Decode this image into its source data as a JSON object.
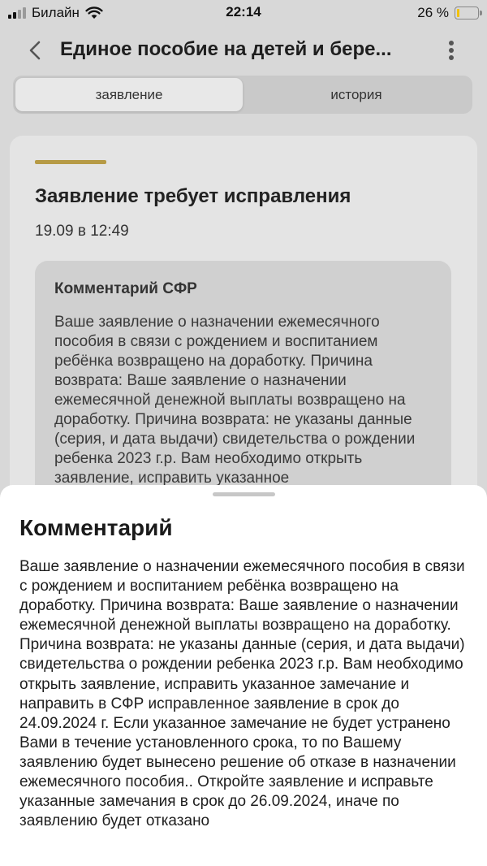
{
  "status_bar": {
    "carrier": "Билайн",
    "time": "22:14",
    "battery_percent": "26 %",
    "battery_level": 0.26,
    "battery_color": "#f3c100"
  },
  "nav": {
    "back_icon": "chevron-left-icon",
    "title": "Единое пособие на детей и бере...",
    "more_icon": "more-vertical-icon"
  },
  "tabs": [
    {
      "label": "заявление",
      "active": true
    },
    {
      "label": "история",
      "active": false
    }
  ],
  "card": {
    "accent_color": "#b69a45",
    "title": "Заявление требует исправления",
    "date": "19.09 в 12:49",
    "comment_heading": "Комментарий СФР",
    "comment_preview": "Ваше заявление о назначении ежемесячного пособия в связи с рождением и воспитанием ребёнка возвращено на доработку. Причина возврата: Ваше заявление о назначении ежемесячной денежной выплаты возвращено на доработку. Причина возврата: не указаны данные (серия, и дата выдачи) свидетельства о рождении ребенка 2023 г.р. Вам необходимо открыть заявление, исправить указанное"
  },
  "sheet": {
    "title": "Комментарий",
    "text": "Ваше заявление о назначении ежемесячного пособия в связи с рождением и воспитанием ребёнка возвращено на доработку. Причина возврата: Ваше заявление о назначении ежемесячной денежной выплаты возвращено на доработку. Причина возврата: не указаны данные (серия, и дата выдачи) свидетельства о рождении ребенка 2023 г.р. Вам необходимо открыть заявление, исправить указанное замечание и направить в СФР исправленное заявление в срок до 24.09.2024 г. Если указанное замечание не будет устранено Вами в течение установленного срока, то по Вашему заявлению будет вынесено решение об отказе в назначении ежемесячного пособия.. Откройте заявление и исправьте указанные замечания в срок до 26.09.2024, иначе по заявлению будет отказано"
  }
}
